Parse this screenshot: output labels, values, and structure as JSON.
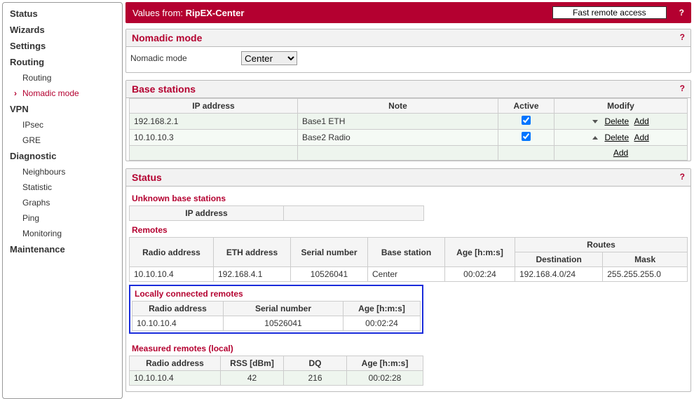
{
  "banner": {
    "prefix": "Values from:",
    "device": "RipEX-Center",
    "remote_button": "Fast remote access",
    "help": "?"
  },
  "sidebar": {
    "status": "Status",
    "wizards": "Wizards",
    "settings": "Settings",
    "routing": "Routing",
    "routing_sub": "Routing",
    "nomadic": "Nomadic mode",
    "vpn": "VPN",
    "ipsec": "IPsec",
    "gre": "GRE",
    "diagnostic": "Diagnostic",
    "neighbours": "Neighbours",
    "statistic": "Statistic",
    "graphs": "Graphs",
    "ping": "Ping",
    "monitoring": "Monitoring",
    "maintenance": "Maintenance"
  },
  "nomadic_panel": {
    "title": "Nomadic mode",
    "label": "Nomadic mode",
    "value": "Center",
    "help": "?"
  },
  "bs_panel": {
    "title": "Base stations",
    "help": "?",
    "headers": {
      "ip": "IP address",
      "note": "Note",
      "active": "Active",
      "modify": "Modify"
    },
    "rows": [
      {
        "ip": "192.168.2.1",
        "note": "Base1 ETH",
        "active": true,
        "dir": "down"
      },
      {
        "ip": "10.10.10.3",
        "note": "Base2 Radio",
        "active": true,
        "dir": "up"
      }
    ],
    "delete": "Delete",
    "add": "Add"
  },
  "status_panel": {
    "title": "Status",
    "help": "?",
    "unknown": {
      "title": "Unknown base stations",
      "header": "IP address"
    },
    "remotes": {
      "title": "Remotes",
      "headers": {
        "radio": "Radio address",
        "eth": "ETH address",
        "serial": "Serial number",
        "base": "Base station",
        "age": "Age [h:m:s]",
        "routes": "Routes",
        "dest": "Destination",
        "mask": "Mask"
      },
      "rows": [
        {
          "radio": "10.10.10.4",
          "eth": "192.168.4.1",
          "serial": "10526041",
          "base": "Center",
          "age": "00:02:24",
          "dest": "192.168.4.0/24",
          "mask": "255.255.255.0"
        }
      ]
    },
    "local": {
      "title": "Locally connected remotes",
      "headers": {
        "radio": "Radio address",
        "serial": "Serial number",
        "age": "Age [h:m:s]"
      },
      "rows": [
        {
          "radio": "10.10.10.4",
          "serial": "10526041",
          "age": "00:02:24"
        }
      ]
    },
    "measured": {
      "title": "Measured remotes (local)",
      "headers": {
        "radio": "Radio address",
        "rss": "RSS [dBm]",
        "dq": "DQ",
        "age": "Age [h:m:s]"
      },
      "rows": [
        {
          "radio": "10.10.10.4",
          "rss": "42",
          "dq": "216",
          "age": "00:02:28"
        }
      ]
    }
  }
}
